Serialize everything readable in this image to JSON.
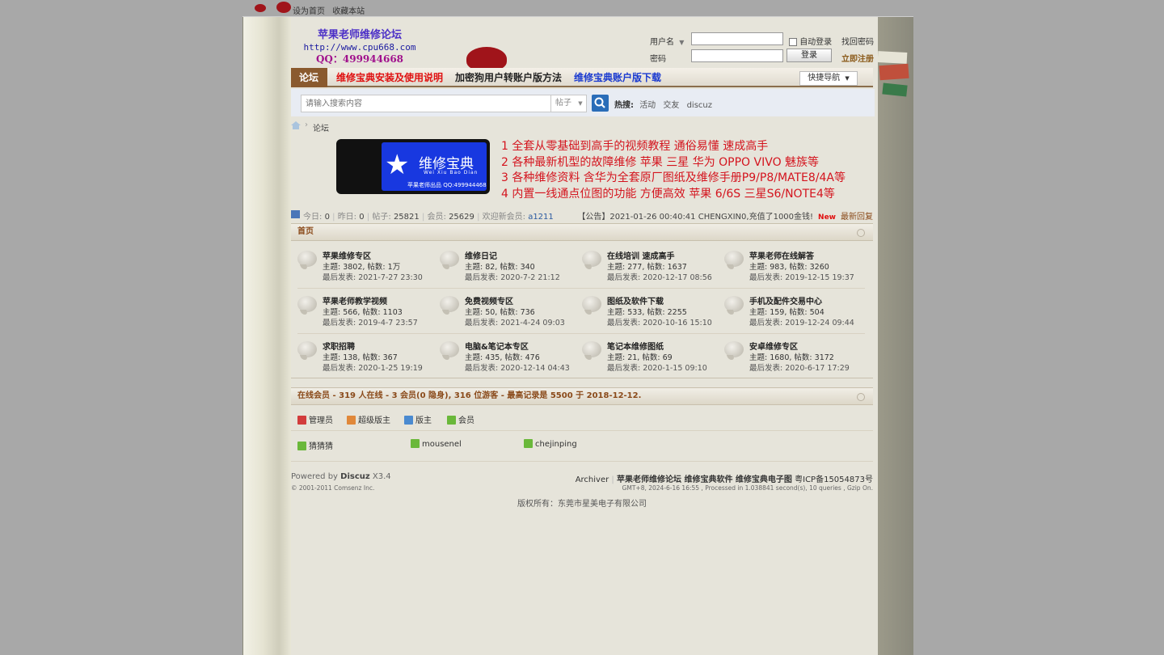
{
  "top_links": [
    "设为首页",
    "收藏本站"
  ],
  "brand": {
    "title": "苹果老师维修论坛",
    "url": "http://www.cpu668.com",
    "qq": "QQ：499944668"
  },
  "login": {
    "username_label": "用户名",
    "password_label": "密码",
    "auto_login": "自动登录",
    "forgot": "找回密码",
    "login_button": "登录",
    "register": "立即注册"
  },
  "nav": {
    "items": [
      "论坛",
      "维修宝典安装及使用说明",
      "加密狗用户转账户版方法",
      "维修宝典账户版下载"
    ],
    "quick_nav": "快捷导航"
  },
  "search": {
    "placeholder": "请输入搜索内容",
    "type": "帖子",
    "hot_label": "热搜:",
    "hot_terms": [
      "活动",
      "交友",
      "discuz"
    ]
  },
  "breadcrumb": "论坛",
  "banner": {
    "product_name": "维修宝典",
    "pinyin": "Wei Xiu Bao Dian",
    "note": "苹果老师出品 QQ:499944468",
    "lines": [
      "1 全套从零基础到高手的视频教程 通俗易懂 速成高手",
      "2 各种最新机型的故障维修 苹果 三星 华为 OPPO VIVO  魅族等",
      "3 各种维修资料 含华为全套原厂图纸及维修手册P9/P8/MATE8/4A等",
      "4 内置一线通点位图的功能 方便高效 苹果 6/6S  三星S6/NOTE4等"
    ]
  },
  "stats": {
    "today_label": "今日:",
    "today": "0",
    "yesterday_label": "昨日:",
    "yesterday": "0",
    "posts_label": "帖子:",
    "posts": "25821",
    "members_label": "会员:",
    "members": "25629",
    "welcome_label": "欢迎新会员:",
    "newest_member": "a1211",
    "notice": "【公告】2021-01-26 00:40:41 CHENGXIN0,充值了1000金钱!",
    "new_badge": "New",
    "latest_reply": "最新回复"
  },
  "forum_section": {
    "title": "首页",
    "forums": [
      {
        "name": "苹果维修专区",
        "stats": "主题: 3802, 帖数: 1万",
        "last": "最后发表: 2021-7-27 23:30"
      },
      {
        "name": "维修日记",
        "stats": "主题: 82, 帖数: 340",
        "last": "最后发表: 2020-7-2 21:12"
      },
      {
        "name": "在线培训 速成高手",
        "stats": "主题: 277, 帖数: 1637",
        "last": "最后发表: 2020-12-17 08:56"
      },
      {
        "name": "苹果老师在线解答",
        "stats": "主题: 983, 帖数: 3260",
        "last": "最后发表: 2019-12-15 19:37"
      },
      {
        "name": "苹果老师教学视频",
        "stats": "主题: 566, 帖数: 1103",
        "last": "最后发表: 2019-4-7 23:57"
      },
      {
        "name": "免费视频专区",
        "stats": "主题: 50, 帖数: 736",
        "last": "最后发表: 2021-4-24 09:03"
      },
      {
        "name": "图纸及软件下载",
        "stats": "主题: 533, 帖数: 2255",
        "last": "最后发表: 2020-10-16 15:10"
      },
      {
        "name": "手机及配件交易中心",
        "stats": "主题: 159, 帖数: 504",
        "last": "最后发表: 2019-12-24 09:44"
      },
      {
        "name": "求职招聘",
        "stats": "主题: 138, 帖数: 367",
        "last": "最后发表: 2020-1-25 19:19"
      },
      {
        "name": "电脑&笔记本专区",
        "stats": "主题: 435, 帖数: 476",
        "last": "最后发表: 2020-12-14 04:43"
      },
      {
        "name": "笔记本维修图纸",
        "stats": "主题: 21, 帖数: 69",
        "last": "最后发表: 2020-1-15 09:10"
      },
      {
        "name": "安卓维修专区",
        "stats": "主题: 1680, 帖数: 3172",
        "last": "最后发表: 2020-6-17 17:29"
      }
    ]
  },
  "online": {
    "title": "在线会员 - 319 人在线 - 3 会员(0 隐身), 316 位游客 - 最高记录是 5500 于 2018-12-12.",
    "legend": [
      {
        "label": "管理员",
        "color": "#d23c3c"
      },
      {
        "label": "超级版主",
        "color": "#e0883a"
      },
      {
        "label": "版主",
        "color": "#4a8ad0"
      },
      {
        "label": "会员",
        "color": "#6ab83a"
      }
    ],
    "users": [
      "猜猜猜",
      "mousenel",
      "chejinping"
    ]
  },
  "footer": {
    "powered_prefix": "Powered by",
    "powered_name": "Discuz",
    "version": "X3.4",
    "copyright": "© 2001-2011 Comsenz Inc.",
    "archiver": "Archiver",
    "site_links": "苹果老师维修论坛 维修宝典软件 维修宝典电子图",
    "icp": "粤ICP备15054873号",
    "debug": "GMT+8, 2024-6-16 16:55 , Processed in 1.038841 second(s), 10 queries , Gzip On.",
    "rights": "版权所有：东莞市星美电子有限公司"
  },
  "colors": {
    "nav_active": "#8a5a2e",
    "nav_link_red": "#e01010",
    "nav_link_blue": "#1a3ad0",
    "banner_text": "#d4141e",
    "search_button": "#2a6db8"
  }
}
